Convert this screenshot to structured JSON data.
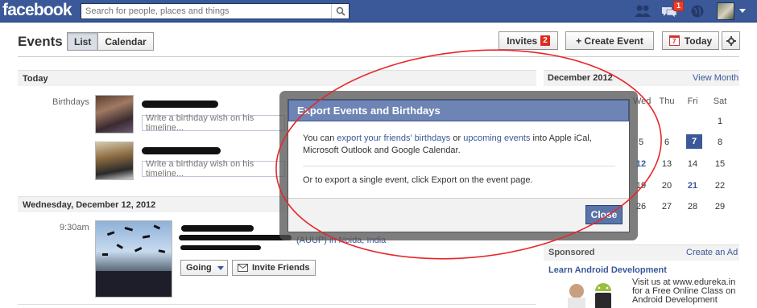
{
  "topbar": {
    "logo": "facebook",
    "search_placeholder": "Search for people, places and things",
    "messages_badge": "1"
  },
  "header": {
    "title": "Events",
    "view_tabs": [
      "List",
      "Calendar"
    ],
    "invites_label": "Invites",
    "invites_count": "2",
    "create_event_label": "+ Create Event",
    "today_label": "Today",
    "today_icon_day": "7"
  },
  "today_section": {
    "heading": "Today",
    "birthdays_label": "Birthdays",
    "wish_placeholder": "Write a birthday wish on his timeline..."
  },
  "event_section": {
    "heading": "Wednesday, December 12, 2012",
    "time": "9:30am",
    "location_partial": "(AUUP) in Noida, India",
    "going_label": "Going",
    "invite_label": "Invite Friends"
  },
  "calendar": {
    "month": "December 2012",
    "view_month": "View Month",
    "weekdays_visible": [
      "Wed",
      "Thu",
      "Fri",
      "Sat"
    ],
    "rows": [
      [
        "",
        "",
        "",
        "1"
      ],
      [
        "5",
        "6",
        "7",
        "8"
      ],
      [
        "12",
        "13",
        "14",
        "15"
      ],
      [
        "19",
        "20",
        "21",
        "22"
      ],
      [
        "26",
        "27",
        "28",
        "29"
      ]
    ],
    "today_day": "7",
    "bold_days": [
      "12",
      "21"
    ]
  },
  "sponsored": {
    "label": "Sponsored",
    "create_ad": "Create an Ad",
    "ad_title": "Learn Android Development",
    "ad_text_line1": "Visit us at www.edureka.in",
    "ad_text_line2": "for a Free Online Class on",
    "ad_text_line3": "Android Development"
  },
  "dialog": {
    "title": "Export Events and Birthdays",
    "p1_prefix": "You can ",
    "p1_link1": "export your friends' birthdays",
    "p1_mid": " or ",
    "p1_link2": "upcoming events",
    "p1_suffix": " into Apple iCal, Microsoft Outlook and Google Calendar.",
    "p2": "Or to export a single event, click Export on the event page.",
    "close_label": "Close"
  },
  "colors": {
    "brand_blue": "#3b5998",
    "dialog_header": "#6d84b4",
    "badge_red": "#e02a1e",
    "annotation_red": "#e8262b"
  }
}
